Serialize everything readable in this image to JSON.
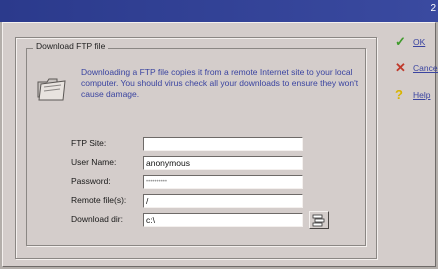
{
  "group": {
    "title": "Download FTP file",
    "description": "Downloading a FTP file copies it from a remote Internet site to your local computer. You should virus check all your downloads to ensure they won't cause damage."
  },
  "form": {
    "ftp_site": {
      "label": "FTP Site:",
      "value": ""
    },
    "user_name": {
      "label": "User Name:",
      "value": "anonymous"
    },
    "password": {
      "label": "Password:",
      "value": "••••••••••"
    },
    "remote_files": {
      "label": "Remote file(s):",
      "value": "/"
    },
    "download_dir": {
      "label": "Download dir:",
      "value": "c:\\"
    }
  },
  "buttons": {
    "ok": "OK",
    "cancel": "Cancel",
    "help": "Help"
  },
  "colors": {
    "titlebar": "#2b3a8c",
    "dialog": "#d4cdcb",
    "text_accent": "#3a44a0",
    "ok_check": "#3f9b2b",
    "cancel_x": "#c0392b",
    "help_q": "#d8b400"
  },
  "icons": {
    "main": "folder-icon",
    "browse": "browse-folder-icon",
    "ok": "checkmark-icon",
    "cancel": "x-icon",
    "help": "question-mark-icon"
  }
}
